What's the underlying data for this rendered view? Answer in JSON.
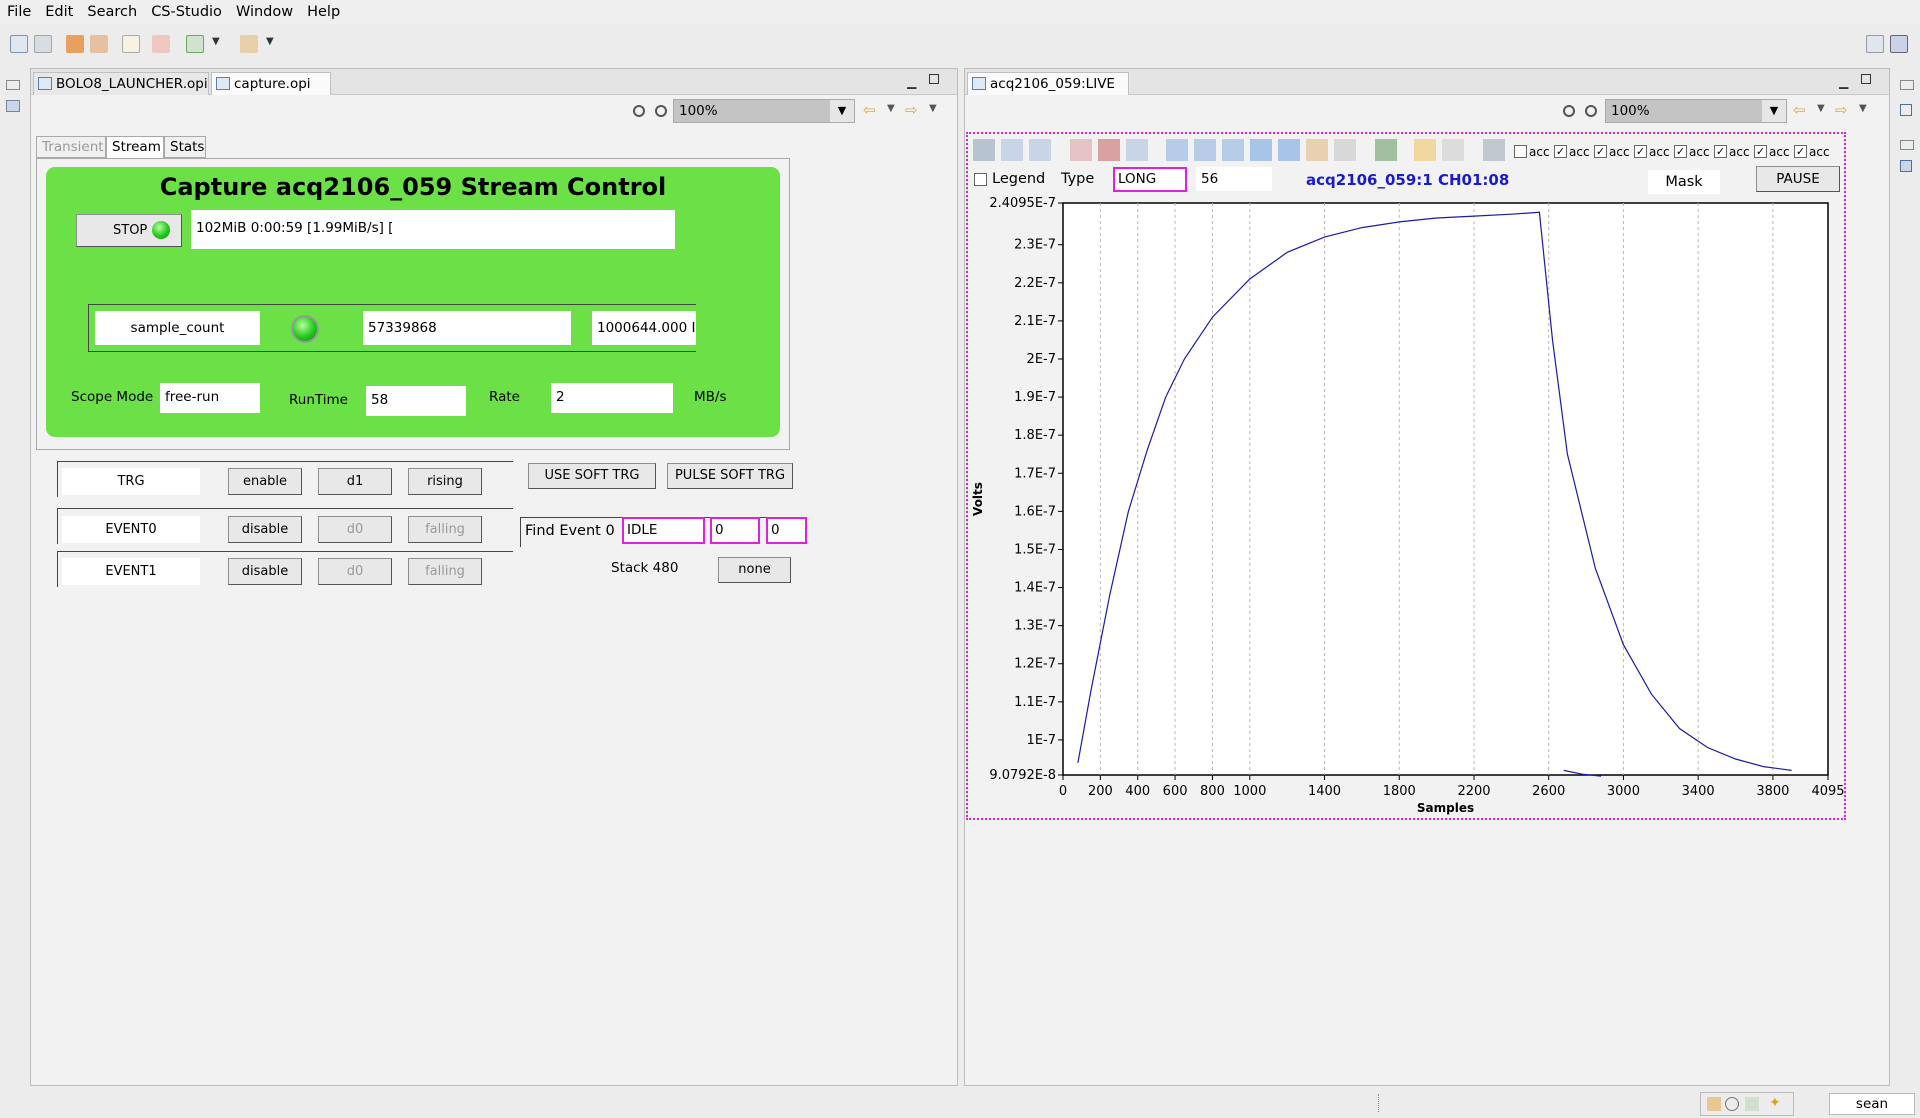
{
  "menu": [
    "File",
    "Edit",
    "Search",
    "CS-Studio",
    "Window",
    "Help"
  ],
  "left_editor": {
    "tabs": [
      {
        "label": "BOLO8_LAUNCHER.opi"
      },
      {
        "label": "capture.opi"
      }
    ],
    "close_glyph": "⊠",
    "zoom": "100%",
    "opi_tabs": [
      "Transient",
      "Stream",
      "Stats"
    ],
    "title": "Capture acq2106_059 Stream  Control",
    "stop_label": "STOP",
    "status_text": "102MiB 0:00:59 [1.99MiB/s] [",
    "sample_count_label": "sample_count",
    "sample_count_value": "57339868",
    "rate_value": "1000644.000 I",
    "scope_mode_label": "Scope Mode",
    "scope_mode_value": "free-run",
    "runtime_label": "RunTime",
    "runtime_value": "58",
    "rate_label": "Rate",
    "rate_mbs_value": "2",
    "rate_unit": "MB/s",
    "trg": {
      "label": "TRG",
      "b1": "enable",
      "b2": "d1",
      "b3": "rising"
    },
    "event0": {
      "label": "EVENT0",
      "b1": "disable",
      "b2": "d0",
      "b3": "falling"
    },
    "event1": {
      "label": "EVENT1",
      "b1": "disable",
      "b2": "d0",
      "b3": "falling"
    },
    "use_soft_trg": "USE SOFT TRG",
    "pulse_soft_trg": "PULSE SOFT TRG",
    "find_event_label": "Find Event 0",
    "find_event_state": "IDLE",
    "find_event_v1": "0",
    "find_event_v2": "0",
    "stack_label": "Stack 480",
    "none_button": "none"
  },
  "right_editor": {
    "tab_label": "acq2106_059:LIVE",
    "zoom": "100%",
    "acc_labels": [
      "acc",
      "acc",
      "acc",
      "acc",
      "acc",
      "acc",
      "acc",
      "acc"
    ],
    "acc_checked": [
      false,
      true,
      true,
      true,
      true,
      true,
      true,
      true
    ],
    "legend_label": "Legend",
    "type_label": "Type",
    "type_value": "LONG",
    "value_56": "56",
    "channel_title": "acq2106_059:1 CH01:08",
    "mask_label": "Mask",
    "pause_label": "PAUSE"
  },
  "status": {
    "user": "sean"
  },
  "colors": {
    "panel_green": "#6be047",
    "trace_blue": "#1a1aa8",
    "title_blue": "#1a1ad0",
    "highlight_magenta": "#e020e0"
  },
  "chart_data": {
    "type": "line",
    "xlabel": "Samples",
    "ylabel": "Volts",
    "xlim": [
      0,
      4095
    ],
    "ylim": [
      9.0792e-08,
      2.4095e-07
    ],
    "x_ticks": [
      "0",
      "200",
      "400",
      "600",
      "800",
      "1000",
      "1400",
      "1800",
      "2200",
      "2600",
      "3000",
      "3400",
      "3800",
      "4095"
    ],
    "y_ticks": [
      "9.0792E-8",
      "1E-7",
      "1.1E-7",
      "1.2E-7",
      "1.3E-7",
      "1.4E-7",
      "1.5E-7",
      "1.6E-7",
      "1.7E-7",
      "1.8E-7",
      "1.9E-7",
      "2E-7",
      "2.1E-7",
      "2.2E-7",
      "2.3E-7",
      "2.4095E-7"
    ],
    "y_tick_values": [
      9.0792e-08,
      1e-07,
      1.1e-07,
      1.2e-07,
      1.3e-07,
      1.4e-07,
      1.5e-07,
      1.6e-07,
      1.7e-07,
      1.8e-07,
      1.9e-07,
      2e-07,
      2.1e-07,
      2.2e-07,
      2.3e-07,
      2.4095e-07
    ],
    "x_tick_values": [
      0,
      200,
      400,
      600,
      800,
      1000,
      1400,
      1800,
      2200,
      2600,
      3000,
      3400,
      3800,
      4095
    ],
    "grid": "x",
    "series": [
      {
        "x": [
          80,
          150,
          250,
          350,
          450,
          550,
          650,
          800,
          1000,
          1200,
          1400,
          1600,
          1800,
          2000,
          2200,
          2400,
          2550,
          2620,
          2700,
          2850,
          3000,
          3150,
          3300,
          3450,
          3600,
          3750,
          3900
        ],
        "y": [
          9.4e-08,
          1.13e-07,
          1.38e-07,
          1.6e-07,
          1.76e-07,
          1.9e-07,
          2e-07,
          2.11e-07,
          2.21e-07,
          2.28e-07,
          2.32e-07,
          2.345e-07,
          2.36e-07,
          2.37e-07,
          2.375e-07,
          2.38e-07,
          2.385e-07,
          2.05e-07,
          1.75e-07,
          1.45e-07,
          1.25e-07,
          1.12e-07,
          1.03e-07,
          9.8e-08,
          9.5e-08,
          9.3e-08,
          9.2e-08
        ]
      },
      {
        "x": [
          2680,
          2780,
          2880
        ],
        "y": [
          9.2e-08,
          9.1e-08,
          9.05e-08
        ]
      }
    ]
  }
}
